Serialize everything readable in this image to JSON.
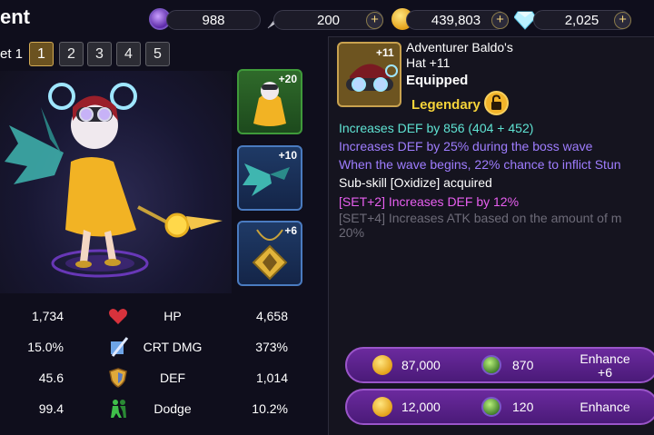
{
  "header": {
    "title": "ent"
  },
  "resources": {
    "stamina": {
      "value": "988",
      "icon": "purple-potion-icon"
    },
    "feather": {
      "value": "200",
      "icon": "feather-icon"
    },
    "gold": {
      "value": "439,803",
      "icon": "gold-coin-icon"
    },
    "diamond": {
      "value": "2,025",
      "icon": "diamond-icon"
    },
    "plus": "+"
  },
  "sets": {
    "label": "et 1",
    "tabs": [
      "1",
      "2",
      "3",
      "4",
      "5"
    ],
    "active_index": 0
  },
  "equipment_slots": [
    {
      "plus": "+20",
      "icon": "costume-slot-icon",
      "border": "#3f9a3a"
    },
    {
      "plus": "+10",
      "icon": "wings-slot-icon",
      "border": "#4a7bc0"
    },
    {
      "plus": "+6",
      "icon": "amulet-slot-icon",
      "border": "#4a7bc0"
    }
  ],
  "stats": [
    {
      "left": "1,734",
      "name": "HP",
      "right": "4,658",
      "icon": "heart-icon"
    },
    {
      "left": "15.0%",
      "name": "CRT DMG",
      "right": "373%",
      "icon": "crit-sword-icon"
    },
    {
      "left": "45.6",
      "name": "DEF",
      "right": "1,014",
      "icon": "shield-icon"
    },
    {
      "left": "99.4",
      "name": "Dodge",
      "right": "10.2%",
      "icon": "dodge-figure-icon"
    }
  ],
  "item": {
    "plus": "+11",
    "name_line1": "Adventurer Baldo's",
    "name_line2": "Hat +11",
    "status": "Equipped",
    "rarity": "Legendary",
    "icon": "goggles-hat-icon",
    "descriptions": [
      {
        "text": "Increases DEF by 856 (404 + 452)",
        "color": "#5fe3d3"
      },
      {
        "text": "Increases DEF by 25% during the boss wave",
        "color": "#9f7dff"
      },
      {
        "text": "When the wave begins, 22% chance to inflict Stun",
        "color": "#9f7dff"
      },
      {
        "text": "Sub-skill [Oxidize] acquired",
        "color": "#ffffff"
      },
      {
        "text": "[SET+2] Increases DEF by 12%",
        "color": "#e85ff0"
      },
      {
        "text": "[SET+4] Increases ATK based on the amount of m",
        "color": "#6d6b78"
      },
      {
        "text": "20%",
        "color": "#6d6b78"
      }
    ]
  },
  "enhance": [
    {
      "gold": "87,000",
      "gems": "870",
      "label_line1": "Enhance",
      "label_line2": "+6"
    },
    {
      "gold": "12,000",
      "gems": "120",
      "label_line1": "Enhance",
      "label_line2": ""
    }
  ]
}
